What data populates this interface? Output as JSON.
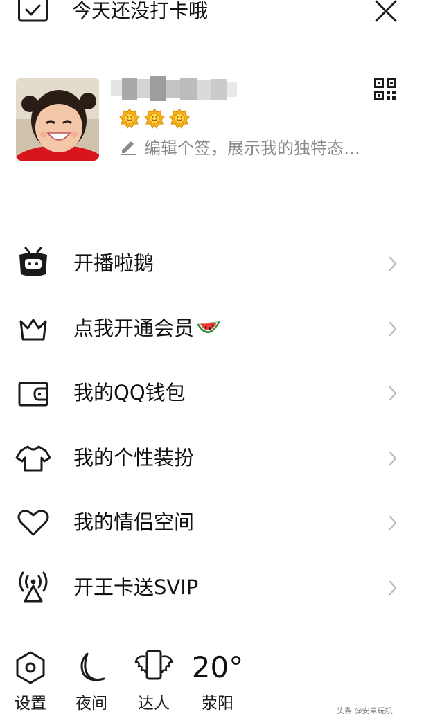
{
  "topbar": {
    "checkin_label": "今天还没打卡哦",
    "checkin_icon": "calendar-check-icon",
    "close_icon": "close-icon"
  },
  "profile": {
    "nickname": "",
    "level_badges": [
      "sun-badge-icon",
      "sun-badge-icon",
      "sun-badge-icon"
    ],
    "signature_placeholder": "编辑个签，展示我的独特态…",
    "qr_icon": "qr-code-icon"
  },
  "menu": [
    {
      "icon": "live-tv-icon",
      "label": "开播啦鹅",
      "emoji": ""
    },
    {
      "icon": "crown-icon",
      "label": "点我开通会员",
      "emoji": "watermelon-icon"
    },
    {
      "icon": "wallet-icon",
      "label": "我的QQ钱包",
      "emoji": ""
    },
    {
      "icon": "tshirt-icon",
      "label": "我的个性装扮",
      "emoji": ""
    },
    {
      "icon": "heart-icon",
      "label": "我的情侣空间",
      "emoji": ""
    },
    {
      "icon": "signal-tower-icon",
      "label": "开王卡送SVIP",
      "emoji": ""
    }
  ],
  "bottom": {
    "settings_label": "设置",
    "night_label": "夜间",
    "expert_label": "达人",
    "temperature": "20°",
    "city": "荥阳"
  },
  "watermark": "头条 @安卓玩机"
}
